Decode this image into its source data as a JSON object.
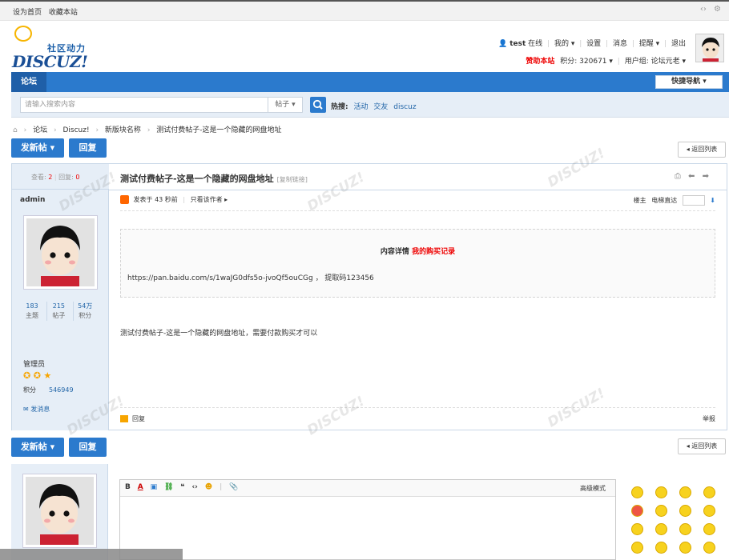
{
  "topbar": {
    "set_home": "设为首页",
    "bookmark": "收藏本站"
  },
  "logo": {
    "cn": "社区动力",
    "en": "DISCUZ!"
  },
  "user": {
    "name": "test",
    "status": "在线",
    "menu": [
      "我的",
      "设置",
      "消息",
      "提醒",
      "退出"
    ],
    "sponsor": "赞助本站",
    "credit_label": "积分: 320671",
    "group_label": "用户组: 论坛元老"
  },
  "nav": {
    "forum_tab": "论坛",
    "quick_nav": "快捷导航"
  },
  "search": {
    "placeholder": "请输入搜索内容",
    "scope": "帖子",
    "hot_label": "热搜:",
    "hot": [
      "活动",
      "交友",
      "discuz"
    ]
  },
  "breadcrumb": [
    "论坛",
    "Discuz!",
    "新版块名称",
    "测试付费帖子-这是一个隐藏的网盘地址"
  ],
  "buttons": {
    "new_thread": "发新帖",
    "reply": "回复",
    "back_to_list": "返回列表"
  },
  "thread": {
    "views_label": "查看:",
    "views": "2",
    "replies_label": "回复:",
    "replies": "0",
    "title": "测试付费帖子-这是一个隐藏的网盘地址",
    "copy_link": "[复制链接]"
  },
  "post": {
    "author": "admin",
    "counts": [
      {
        "value": "183",
        "label": "主题"
      },
      {
        "value": "215",
        "label": "帖子"
      },
      {
        "value": "54万",
        "label": "积分"
      }
    ],
    "group": "管理员",
    "credit_label": "积分",
    "credit_value": "546949",
    "send_pm": "发消息",
    "posted_time": "发表于 43 秒前",
    "only_author": "只看该作者",
    "floor_label": "楼主",
    "jump_label": "电梯直达",
    "locked_title": "内容详情",
    "locked_link": "我的购买记录",
    "url": "https://pan.baidu.com/s/1waJG0dfs5o-jvoQf5ouCGg ， 提取码123456",
    "content": "测试付费帖子-这是一个隐藏的网盘地址，需要付款购买才可以",
    "reply_link": "回复",
    "report": "举报"
  },
  "editor": {
    "advanced_mode": "高级模式"
  },
  "colors": {
    "primary": "#2b7acd",
    "nav_dark": "#1f5fa8",
    "sidebar_bg": "#e6eef7",
    "red": "#e00000"
  }
}
